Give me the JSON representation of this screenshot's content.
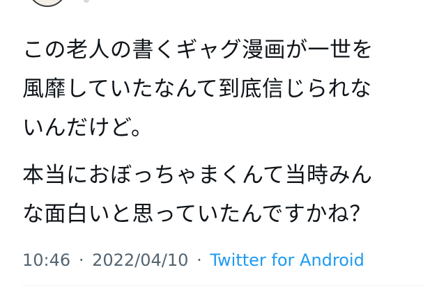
{
  "tweet": {
    "paragraphs": [
      {
        "lines": [
          "この老人の書くギャグ漫画が一世を",
          "風靡していたなんて到底信じられな",
          "いんだけど。"
        ]
      },
      {
        "lines": [
          "本当におぼっちゃまくんて当時みん",
          "な面白いと思っていたんですかね？"
        ]
      }
    ],
    "time": "10:46",
    "separator": "·",
    "date": "2022/04/10",
    "source": "Twitter for Android"
  }
}
